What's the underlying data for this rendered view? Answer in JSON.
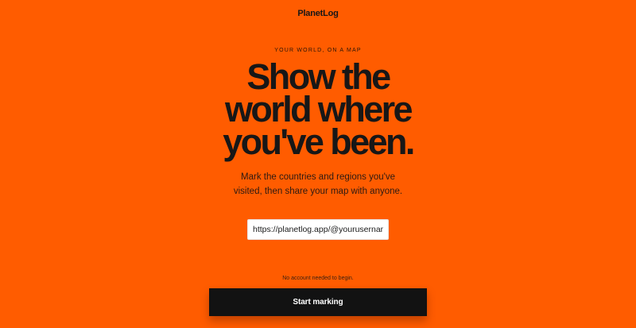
{
  "brand": {
    "name": "PlanetLog"
  },
  "hero": {
    "eyebrow": "YOUR WORLD, ON A MAP",
    "headline_lines": [
      "Show the",
      "world where",
      "you've been."
    ],
    "subtext_lines": [
      "Mark the countries and regions you've",
      "visited, then share your map with anyone."
    ]
  },
  "form": {
    "url_value": "https://planetlog.app/@yourusername",
    "note": "No account needed to begin.",
    "cta_label": "Start marking"
  },
  "colors": {
    "background": "#ff5c00",
    "text": "#161616",
    "button": "#121212",
    "button_text": "#ffffff"
  }
}
